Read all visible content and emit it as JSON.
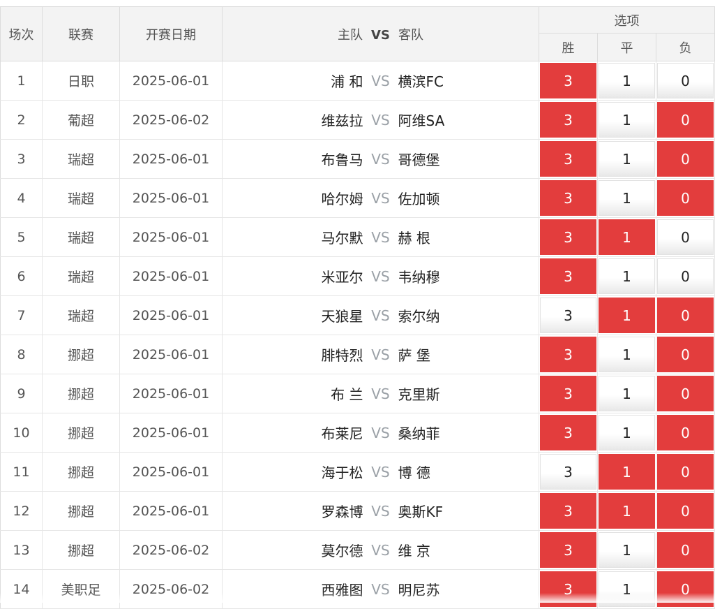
{
  "header": {
    "no": "场次",
    "league": "联赛",
    "date": "开赛日期",
    "home": "主队",
    "vs": "VS",
    "away": "客队",
    "options": "选项",
    "win": "胜",
    "draw": "平",
    "lose": "负"
  },
  "colors": {
    "selected": "#e33d3d",
    "vs_text": "#9aa0a6"
  },
  "rows": [
    {
      "no": "1",
      "league": "日职",
      "date": "2025-06-01",
      "home": "浦 和",
      "vs": "VS",
      "away": "横滨FC",
      "win": "3",
      "draw": "1",
      "lose": "0",
      "win_sel": true,
      "draw_sel": false,
      "lose_sel": false
    },
    {
      "no": "2",
      "league": "葡超",
      "date": "2025-06-02",
      "home": "维兹拉",
      "vs": "VS",
      "away": "阿维SA",
      "win": "3",
      "draw": "1",
      "lose": "0",
      "win_sel": true,
      "draw_sel": false,
      "lose_sel": true
    },
    {
      "no": "3",
      "league": "瑞超",
      "date": "2025-06-01",
      "home": "布鲁马",
      "vs": "VS",
      "away": "哥德堡",
      "win": "3",
      "draw": "1",
      "lose": "0",
      "win_sel": true,
      "draw_sel": false,
      "lose_sel": true
    },
    {
      "no": "4",
      "league": "瑞超",
      "date": "2025-06-01",
      "home": "哈尔姆",
      "vs": "VS",
      "away": "佐加顿",
      "win": "3",
      "draw": "1",
      "lose": "0",
      "win_sel": true,
      "draw_sel": false,
      "lose_sel": true
    },
    {
      "no": "5",
      "league": "瑞超",
      "date": "2025-06-01",
      "home": "马尔默",
      "vs": "VS",
      "away": "赫 根",
      "win": "3",
      "draw": "1",
      "lose": "0",
      "win_sel": true,
      "draw_sel": true,
      "lose_sel": false
    },
    {
      "no": "6",
      "league": "瑞超",
      "date": "2025-06-01",
      "home": "米亚尔",
      "vs": "VS",
      "away": "韦纳穆",
      "win": "3",
      "draw": "1",
      "lose": "0",
      "win_sel": true,
      "draw_sel": false,
      "lose_sel": false
    },
    {
      "no": "7",
      "league": "瑞超",
      "date": "2025-06-01",
      "home": "天狼星",
      "vs": "VS",
      "away": "索尔纳",
      "win": "3",
      "draw": "1",
      "lose": "0",
      "win_sel": false,
      "draw_sel": true,
      "lose_sel": true
    },
    {
      "no": "8",
      "league": "挪超",
      "date": "2025-06-01",
      "home": "腓特烈",
      "vs": "VS",
      "away": "萨 堡",
      "win": "3",
      "draw": "1",
      "lose": "0",
      "win_sel": true,
      "draw_sel": false,
      "lose_sel": true
    },
    {
      "no": "9",
      "league": "挪超",
      "date": "2025-06-01",
      "home": "布 兰",
      "vs": "VS",
      "away": "克里斯",
      "win": "3",
      "draw": "1",
      "lose": "0",
      "win_sel": true,
      "draw_sel": false,
      "lose_sel": true
    },
    {
      "no": "10",
      "league": "挪超",
      "date": "2025-06-01",
      "home": "布莱尼",
      "vs": "VS",
      "away": "桑纳菲",
      "win": "3",
      "draw": "1",
      "lose": "0",
      "win_sel": true,
      "draw_sel": false,
      "lose_sel": true
    },
    {
      "no": "11",
      "league": "挪超",
      "date": "2025-06-01",
      "home": "海于松",
      "vs": "VS",
      "away": "博 德",
      "win": "3",
      "draw": "1",
      "lose": "0",
      "win_sel": false,
      "draw_sel": true,
      "lose_sel": true
    },
    {
      "no": "12",
      "league": "挪超",
      "date": "2025-06-01",
      "home": "罗森博",
      "vs": "VS",
      "away": "奥斯KF",
      "win": "3",
      "draw": "1",
      "lose": "0",
      "win_sel": true,
      "draw_sel": true,
      "lose_sel": true
    },
    {
      "no": "13",
      "league": "挪超",
      "date": "2025-06-02",
      "home": "莫尔德",
      "vs": "VS",
      "away": "维 京",
      "win": "3",
      "draw": "1",
      "lose": "0",
      "win_sel": true,
      "draw_sel": false,
      "lose_sel": true
    },
    {
      "no": "14",
      "league": "美职足",
      "date": "2025-06-02",
      "home": "西雅图",
      "vs": "VS",
      "away": "明尼苏",
      "win": "3",
      "draw": "1",
      "lose": "0",
      "win_sel": true,
      "draw_sel": false,
      "lose_sel": true
    }
  ]
}
